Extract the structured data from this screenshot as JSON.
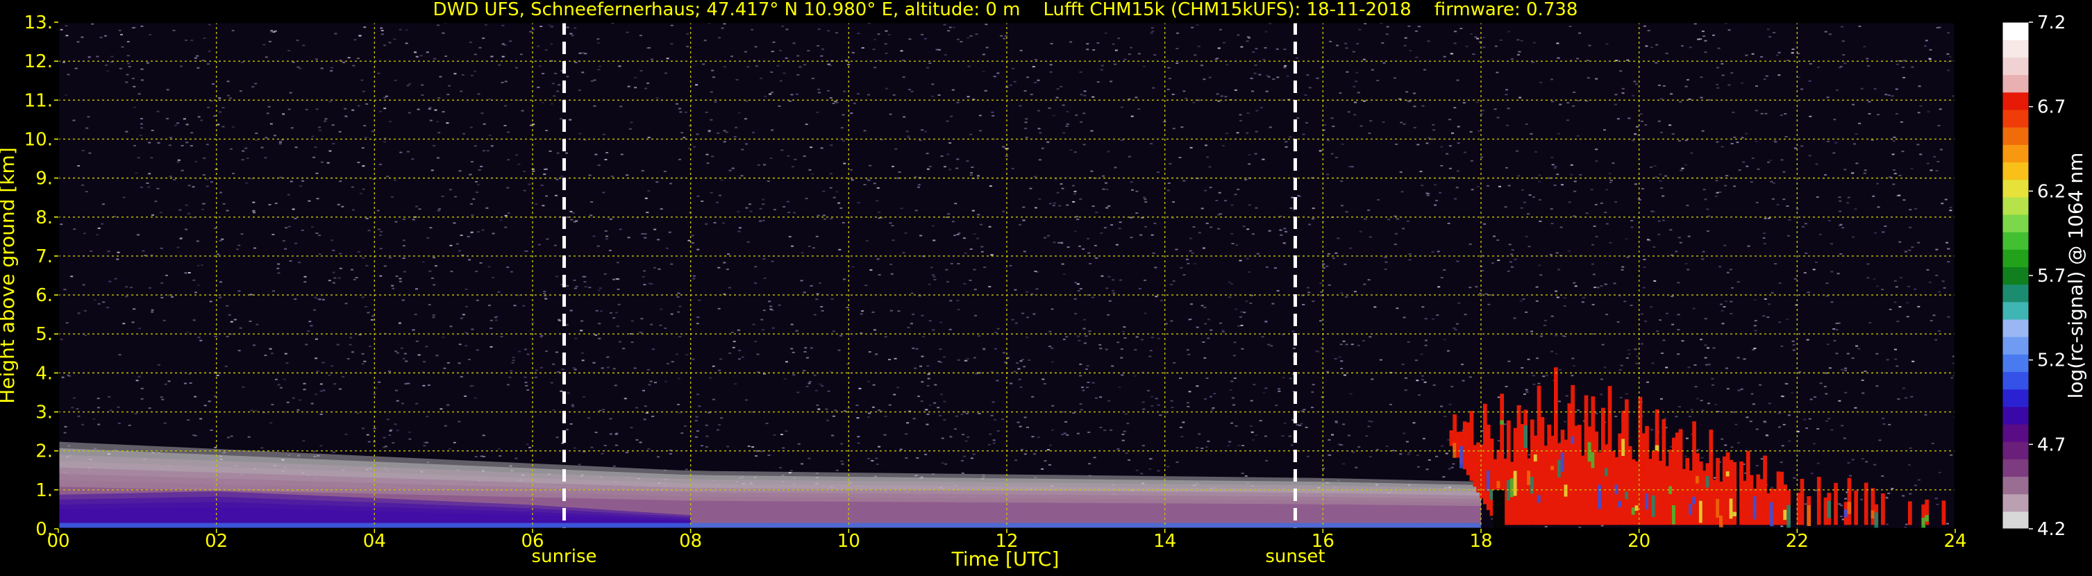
{
  "chart_data": {
    "type": "heatmap",
    "title": "DWD UFS, Schneefernerhaus; 47.417° N 10.980° E, altitude: 0 m    Lufft CHM15k (CHM15kUFS): 18-11-2018    firmware: 0.738",
    "xlabel": "Time [UTC]",
    "ylabel": "Height above ground [km]",
    "xlim": [
      0,
      24
    ],
    "ylim": [
      0,
      13
    ],
    "x_ticks": [
      0,
      2,
      4,
      6,
      8,
      10,
      12,
      14,
      16,
      18,
      20,
      22,
      24
    ],
    "x_tick_labels": [
      "00",
      "02",
      "04",
      "06",
      "08",
      "10",
      "12",
      "14",
      "16",
      "18",
      "20",
      "22",
      "24"
    ],
    "y_ticks": [
      0,
      1,
      2,
      3,
      4,
      5,
      6,
      7,
      8,
      9,
      10,
      11,
      12,
      13
    ],
    "y_tick_labels": [
      "0.",
      "1.",
      "2.",
      "3.",
      "4.",
      "5.",
      "6.",
      "7.",
      "8.",
      "9.",
      "10.",
      "11.",
      "12.",
      "13."
    ],
    "grid": true,
    "annotations": [
      {
        "text": "sunrise",
        "x": 6.4
      },
      {
        "text": "sunset",
        "x": 15.65
      }
    ],
    "colorbar": {
      "label": "log(rc-signal) @ 1064 nm",
      "range": [
        4.2,
        7.2
      ],
      "ticks": [
        4.2,
        4.7,
        5.2,
        5.7,
        6.2,
        6.7,
        7.2
      ],
      "tick_labels": [
        "4.2",
        "4.7",
        "5.2",
        "5.7",
        "6.2",
        "6.7",
        "7.2"
      ],
      "colors": [
        "#d8d8d8",
        "#bba0b2",
        "#9a6e92",
        "#7d3b80",
        "#6a1f7a",
        "#5a0c86",
        "#3b08a8",
        "#2a22d2",
        "#3452e8",
        "#4a7af0",
        "#6f9cf2",
        "#9ab6f4",
        "#3fb6b4",
        "#1c8c70",
        "#10801e",
        "#22a11a",
        "#42c032",
        "#7cd84a",
        "#b6e24a",
        "#e6e23a",
        "#f8c018",
        "#f89810",
        "#f06c0a",
        "#f03c08",
        "#e61a06",
        "#e8b0b0",
        "#f0d2d2",
        "#f8e8e8",
        "#ffffff"
      ]
    },
    "signal_layers": [
      {
        "name": "boundary layer",
        "x": [
          0,
          4,
          8,
          12,
          16,
          18
        ],
        "top_km": [
          2.4,
          2.0,
          1.6,
          1.5,
          1.4,
          1.3
        ],
        "value": 4.6
      },
      {
        "name": "aerosol layer",
        "x": [
          0,
          2,
          4,
          6,
          8
        ],
        "top_km": [
          1.0,
          1.1,
          0.9,
          0.7,
          0.4
        ],
        "value": 4.9
      },
      {
        "name": "cloud",
        "x": [
          17.6,
          18.2,
          19.0,
          20.0,
          21.0,
          22.0,
          24.0
        ],
        "base_km": [
          2.2,
          0.1,
          0.1,
          0.1,
          0.1,
          0.1,
          0.1
        ],
        "top_km": [
          3.0,
          3.5,
          4.2,
          3.6,
          2.5,
          1.5,
          1.0
        ],
        "value": 6.7
      }
    ]
  },
  "colors": {
    "background": "#000000",
    "axis_text": "#ffff00",
    "colorbar_text": "#ffffff",
    "grid": "#c8c800",
    "marker_line": "#ffffff"
  }
}
